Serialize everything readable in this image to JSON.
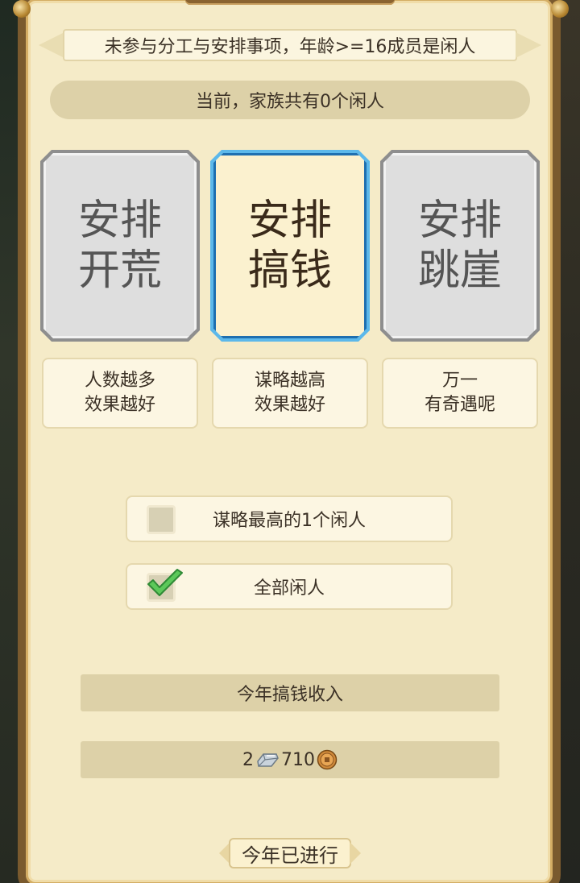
{
  "banner": {
    "text": "未参与分工与安排事项，年龄>=16成员是闲人"
  },
  "status": {
    "text": "当前，家族共有0个闲人"
  },
  "cards": [
    {
      "line1": "安排",
      "line2": "开荒",
      "desc1": "人数越多",
      "desc2": "效果越好",
      "active": false
    },
    {
      "line1": "安排",
      "line2": "搞钱",
      "desc1": "谋略越高",
      "desc2": "效果越好",
      "active": true
    },
    {
      "line1": "安排",
      "line2": "跳崖",
      "desc1": "万一",
      "desc2": "有奇遇呢",
      "active": false
    }
  ],
  "options": [
    {
      "label": "谋略最高的1个闲人",
      "checked": false
    },
    {
      "label": "全部闲人",
      "checked": true
    }
  ],
  "income": {
    "title": "今年搞钱收入",
    "silver": "2",
    "copper": "710"
  },
  "year_progress": {
    "label": "今年已进行"
  },
  "colors": {
    "panel_bg": "#f5ebc8",
    "active_card_border": "#5cb8ea",
    "check_green": "#5cc85a"
  }
}
